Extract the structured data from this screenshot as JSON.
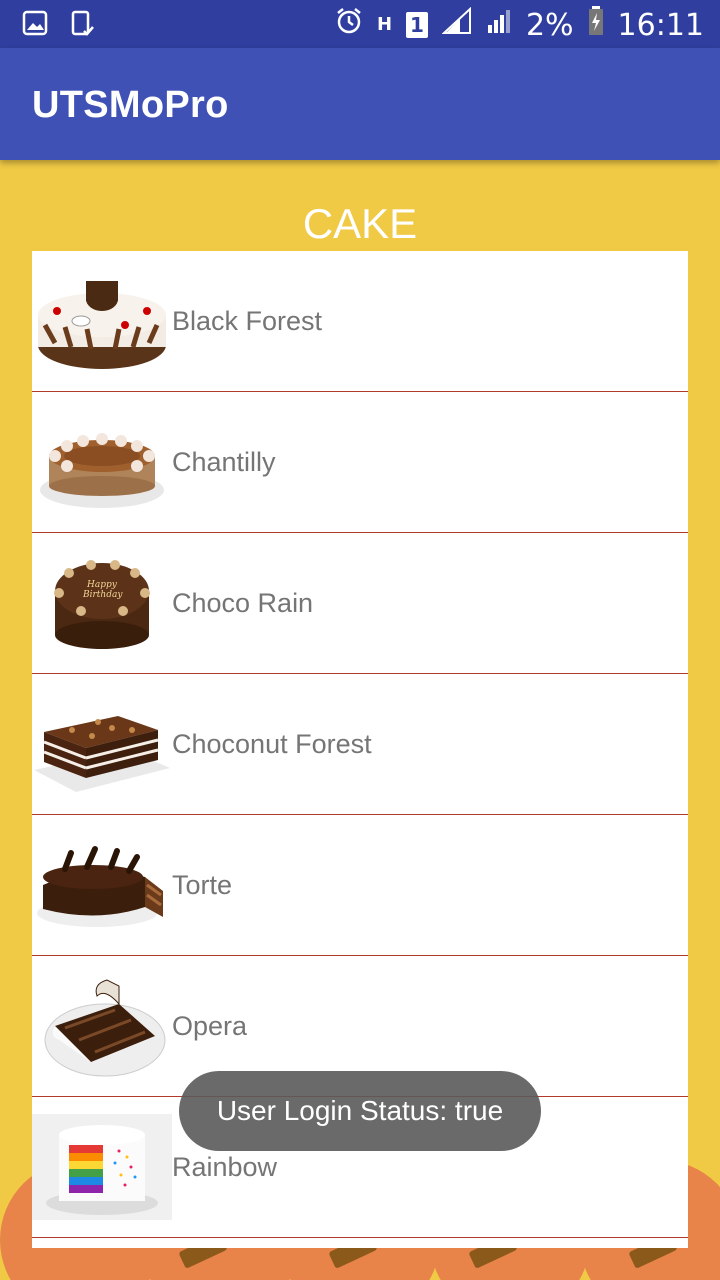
{
  "status_bar": {
    "network_label": "H",
    "sim_label": "1",
    "battery_percent": "2%",
    "time": "16:11"
  },
  "app_bar": {
    "title": "UTSMoPro"
  },
  "section": {
    "title": "CAKE"
  },
  "cakes": [
    {
      "name": "Black Forest"
    },
    {
      "name": "Chantilly"
    },
    {
      "name": "Choco Rain"
    },
    {
      "name": "Choconut Forest"
    },
    {
      "name": "Torte"
    },
    {
      "name": "Opera"
    },
    {
      "name": "Rainbow"
    }
  ],
  "toast": {
    "text": "User Login Status: true"
  },
  "colors": {
    "status_bar": "#303f9f",
    "app_bar": "#3f51b5",
    "background": "#f0c945",
    "divider": "#b23a2a",
    "label_text": "#757575"
  }
}
